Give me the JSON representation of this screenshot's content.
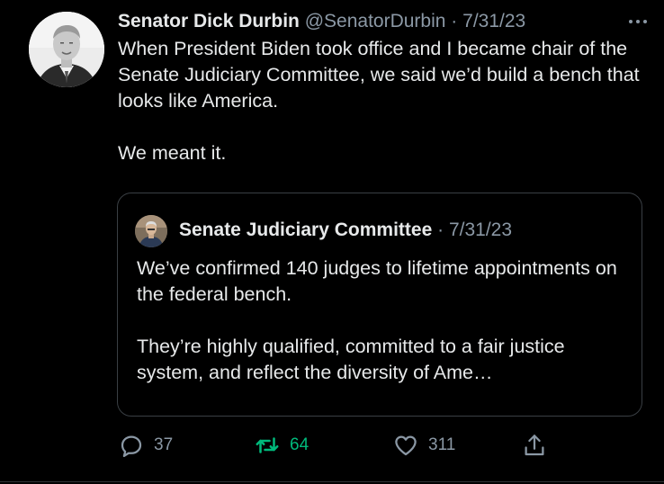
{
  "tweet": {
    "author_name": "Senator Dick Durbin",
    "handle": "@SenatorDurbin",
    "separator": "·",
    "date": "7/31/23",
    "more_icon": "more-horizontal-icon",
    "text_paragraphs": [
      "When President Biden took office and I became chair of the Senate Judiciary Committee, we said we’d build a bench that looks like America.",
      "We meant it."
    ]
  },
  "quote": {
    "author_name": "Senate Judiciary Committee",
    "separator": "·",
    "date": "7/31/23",
    "text_paragraphs": [
      "We’ve confirmed 140 judges to lifetime appointments on the federal bench.",
      "They’re highly qualified, committed to a fair justice system, and reflect the diversity of Ame…"
    ]
  },
  "actions": {
    "reply": {
      "icon": "reply-icon",
      "count": "37"
    },
    "retweet": {
      "icon": "retweet-icon",
      "count": "64"
    },
    "like": {
      "icon": "heart-icon",
      "count": "311"
    },
    "share": {
      "icon": "share-icon"
    }
  },
  "colors": {
    "background": "#000000",
    "text": "#e7e9ea",
    "secondary": "#8b98a5",
    "retweet_active": "#00ba7c",
    "border": "#3a3f44"
  }
}
